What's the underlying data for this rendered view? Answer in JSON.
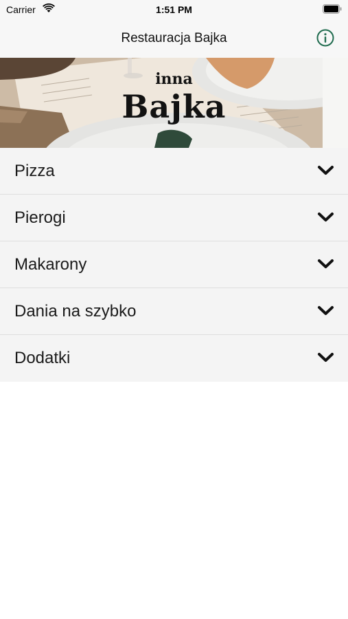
{
  "status_bar": {
    "carrier": "Carrier",
    "time": "1:51 PM"
  },
  "nav": {
    "title": "Restauracja Bajka",
    "info_icon": "info-circle-icon",
    "accent_color": "#1f6b4e"
  },
  "banner": {
    "logo_small": "inna",
    "logo_big": "Bajka"
  },
  "menu": {
    "items": [
      {
        "label": "Pizza",
        "icon": "chevron-down-icon"
      },
      {
        "label": "Pierogi",
        "icon": "chevron-down-icon"
      },
      {
        "label": "Makarony",
        "icon": "chevron-down-icon"
      },
      {
        "label": "Dania na szybko",
        "icon": "chevron-down-icon"
      },
      {
        "label": "Dodatki",
        "icon": "chevron-down-icon"
      }
    ]
  }
}
